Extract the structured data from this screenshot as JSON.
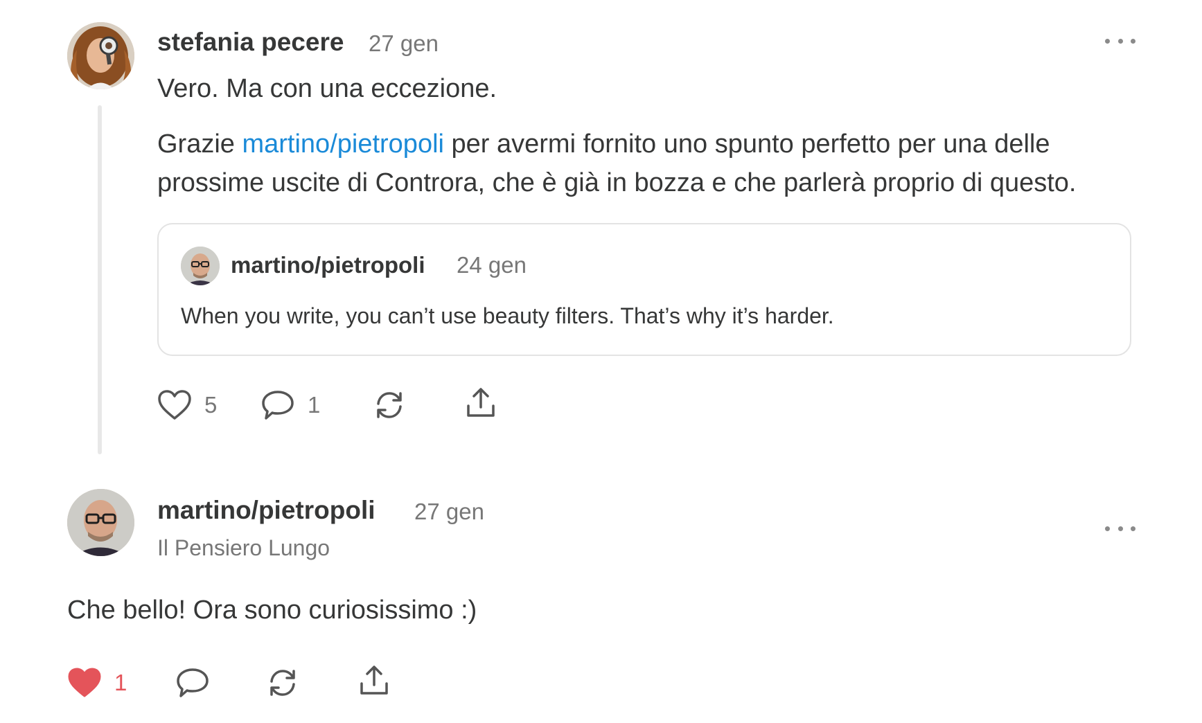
{
  "comment1": {
    "author": "stefania pecere",
    "date": "27 gen",
    "avatar_icon": "woman-with-magnifying-glass-avatar",
    "text_line1": "Vero. Ma con una eccezione.",
    "paragraph_prefix": "Grazie ",
    "mention": "martino/pietropoli",
    "paragraph_rest_line1": " per avermi fornito uno spunto perfetto per una delle",
    "paragraph_line2": "prossime uscite di Controra, che è già in bozza e che parlerà proprio di questo.",
    "quote": {
      "author": "martino/pietropoli",
      "date": "24 gen",
      "text": "When you write, you can’t use beauty filters. That’s why it’s harder."
    },
    "actions": {
      "like_count": "5",
      "comment_count": "1",
      "liked": false
    }
  },
  "comment2": {
    "author": "martino/pietropoli",
    "date": "27 gen",
    "subtitle": "Il Pensiero Lungo",
    "avatar_icon": "man-with-glasses-avatar",
    "text": "Che bello! Ora sono curiosissimo :)",
    "actions": {
      "like_count": "1",
      "liked": true
    }
  },
  "colors": {
    "link": "#1a8ad8",
    "text": "#363737",
    "muted": "#777777",
    "like_active": "#e4545a",
    "thread_line": "#e8e8e8"
  }
}
